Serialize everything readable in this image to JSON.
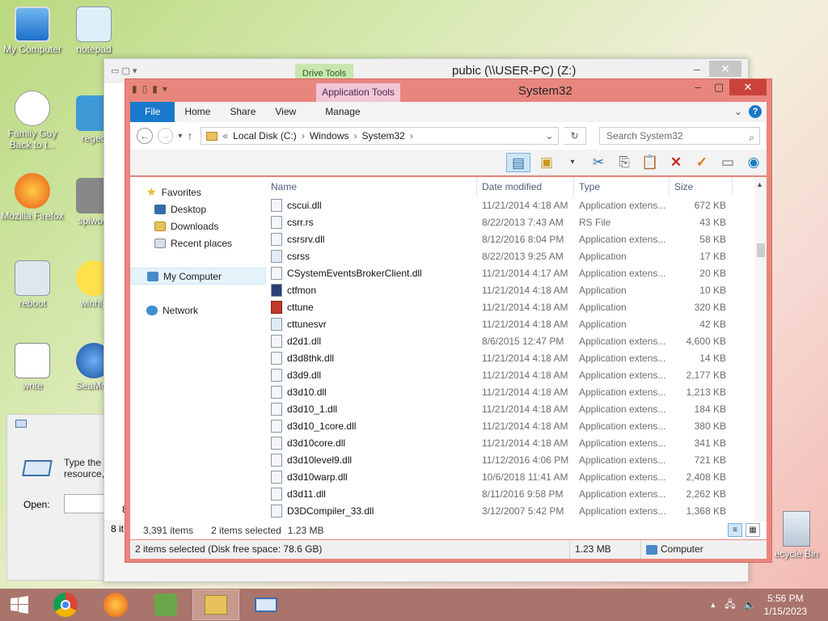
{
  "desktop": {
    "icons": [
      {
        "label": "My Computer"
      },
      {
        "label": "notepad"
      },
      {
        "label": "Family Guy Back to t..."
      },
      {
        "label": "reged"
      },
      {
        "label": "Mozilla Firefox"
      },
      {
        "label": "splwow"
      },
      {
        "label": "reboot"
      },
      {
        "label": "winhlp"
      },
      {
        "label": "write"
      },
      {
        "label": "SeaMon"
      }
    ],
    "recycle_bin": "ecycle Bin"
  },
  "back_window": {
    "context_tab": "Drive Tools",
    "title": "pubic (\\\\USER-PC) (Z:)"
  },
  "run_dialog": {
    "text1": "Type the",
    "text2": "resource,",
    "open_label": "Open:",
    "count": "8",
    "items": "8 it"
  },
  "window": {
    "title": "System32",
    "context_tab": "Application Tools",
    "tabs": {
      "file": "File",
      "home": "Home",
      "share": "Share",
      "view": "View",
      "manage": "Manage"
    },
    "help": "?",
    "address": {
      "prefix": "«",
      "parts": [
        "Local Disk (C:)",
        "Windows",
        "System32"
      ]
    },
    "search_placeholder": "Search System32",
    "nav": {
      "favorites": "Favorites",
      "desktop": "Desktop",
      "downloads": "Downloads",
      "recent": "Recent places",
      "computer": "My Computer",
      "network": "Network"
    },
    "columns": {
      "name": "Name",
      "date": "Date modified",
      "type": "Type",
      "size": "Size"
    },
    "files": [
      {
        "name": "cscui.dll",
        "date": "11/21/2014 4:18 AM",
        "type": "Application extens...",
        "size": "672 KB",
        "icon": "dll"
      },
      {
        "name": "csrr.rs",
        "date": "8/22/2013 7:43 AM",
        "type": "RS File",
        "size": "43 KB",
        "icon": "file"
      },
      {
        "name": "csrsrv.dll",
        "date": "8/12/2016 8:04 PM",
        "type": "Application extens...",
        "size": "58 KB",
        "icon": "dll"
      },
      {
        "name": "csrss",
        "date": "8/22/2013 9:25 AM",
        "type": "Application",
        "size": "17 KB",
        "icon": "app"
      },
      {
        "name": "CSystemEventsBrokerClient.dll",
        "date": "11/21/2014 4:17 AM",
        "type": "Application extens...",
        "size": "20 KB",
        "icon": "dll"
      },
      {
        "name": "ctfmon",
        "date": "11/21/2014 4:18 AM",
        "type": "Application",
        "size": "10 KB",
        "icon": "pen"
      },
      {
        "name": "cttune",
        "date": "11/21/2014 4:18 AM",
        "type": "Application",
        "size": "320 KB",
        "icon": "red"
      },
      {
        "name": "cttunesvr",
        "date": "11/21/2014 4:18 AM",
        "type": "Application",
        "size": "42 KB",
        "icon": "app"
      },
      {
        "name": "d2d1.dll",
        "date": "8/6/2015 12:47 PM",
        "type": "Application extens...",
        "size": "4,600 KB",
        "icon": "dll"
      },
      {
        "name": "d3d8thk.dll",
        "date": "11/21/2014 4:18 AM",
        "type": "Application extens...",
        "size": "14 KB",
        "icon": "dll"
      },
      {
        "name": "d3d9.dll",
        "date": "11/21/2014 4:18 AM",
        "type": "Application extens...",
        "size": "2,177 KB",
        "icon": "dll"
      },
      {
        "name": "d3d10.dll",
        "date": "11/21/2014 4:18 AM",
        "type": "Application extens...",
        "size": "1,213 KB",
        "icon": "dll"
      },
      {
        "name": "d3d10_1.dll",
        "date": "11/21/2014 4:18 AM",
        "type": "Application extens...",
        "size": "184 KB",
        "icon": "dll"
      },
      {
        "name": "d3d10_1core.dll",
        "date": "11/21/2014 4:18 AM",
        "type": "Application extens...",
        "size": "380 KB",
        "icon": "dll"
      },
      {
        "name": "d3d10core.dll",
        "date": "11/21/2014 4:18 AM",
        "type": "Application extens...",
        "size": "341 KB",
        "icon": "dll"
      },
      {
        "name": "d3d10level9.dll",
        "date": "11/12/2016 4:06 PM",
        "type": "Application extens...",
        "size": "721 KB",
        "icon": "dll"
      },
      {
        "name": "d3d10warp.dll",
        "date": "10/6/2018 11:41 AM",
        "type": "Application extens...",
        "size": "2,408 KB",
        "icon": "dll"
      },
      {
        "name": "d3d11.dll",
        "date": "8/11/2016 9:58 PM",
        "type": "Application extens...",
        "size": "2,262 KB",
        "icon": "dll"
      },
      {
        "name": "D3DCompiler_33.dll",
        "date": "3/12/2007 5:42 PM",
        "type": "Application extens...",
        "size": "1,368 KB",
        "icon": "dll"
      }
    ],
    "status": {
      "items": "3,391 items",
      "selected": "2 items selected",
      "size": "1.23 MB"
    },
    "bottom": {
      "info": "2 items selected (Disk free space: 78.6 GB)",
      "size": "1.23 MB",
      "location": "Computer"
    }
  },
  "taskbar": {
    "time": "5:56 PM",
    "date": "1/15/2023"
  }
}
